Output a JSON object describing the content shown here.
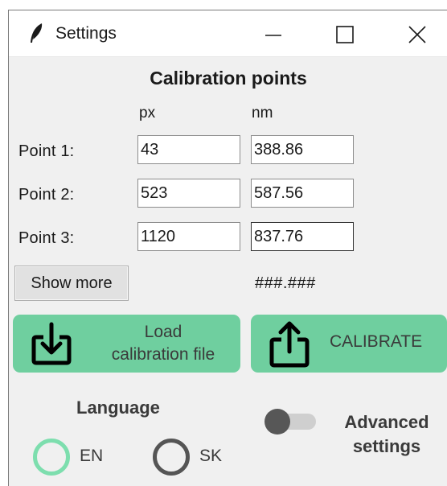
{
  "window": {
    "title": "Settings"
  },
  "calibration": {
    "title": "Calibration points",
    "col_px": "px",
    "col_nm": "nm",
    "points": [
      {
        "label": "Point  1:",
        "px": "43",
        "nm": "388.86"
      },
      {
        "label": "Point  2:",
        "px": "523",
        "nm": "587.56"
      },
      {
        "label": "Point  3:",
        "px": "1120",
        "nm": "837.76"
      }
    ]
  },
  "show_more_label": "Show more",
  "mask_text": "###.###",
  "buttons": {
    "load_line1": "Load",
    "load_line2": "calibration file",
    "calibrate": "CALIBRATE"
  },
  "language": {
    "title": "Language",
    "options": [
      "EN",
      "SK"
    ],
    "selected": "EN"
  },
  "advanced": {
    "line1": "Advanced",
    "line2": "settings",
    "enabled": false
  },
  "colors": {
    "accent_green": "#6fcf9f",
    "radio_selected": "#7ddeae",
    "radio_unselected": "#555555"
  }
}
